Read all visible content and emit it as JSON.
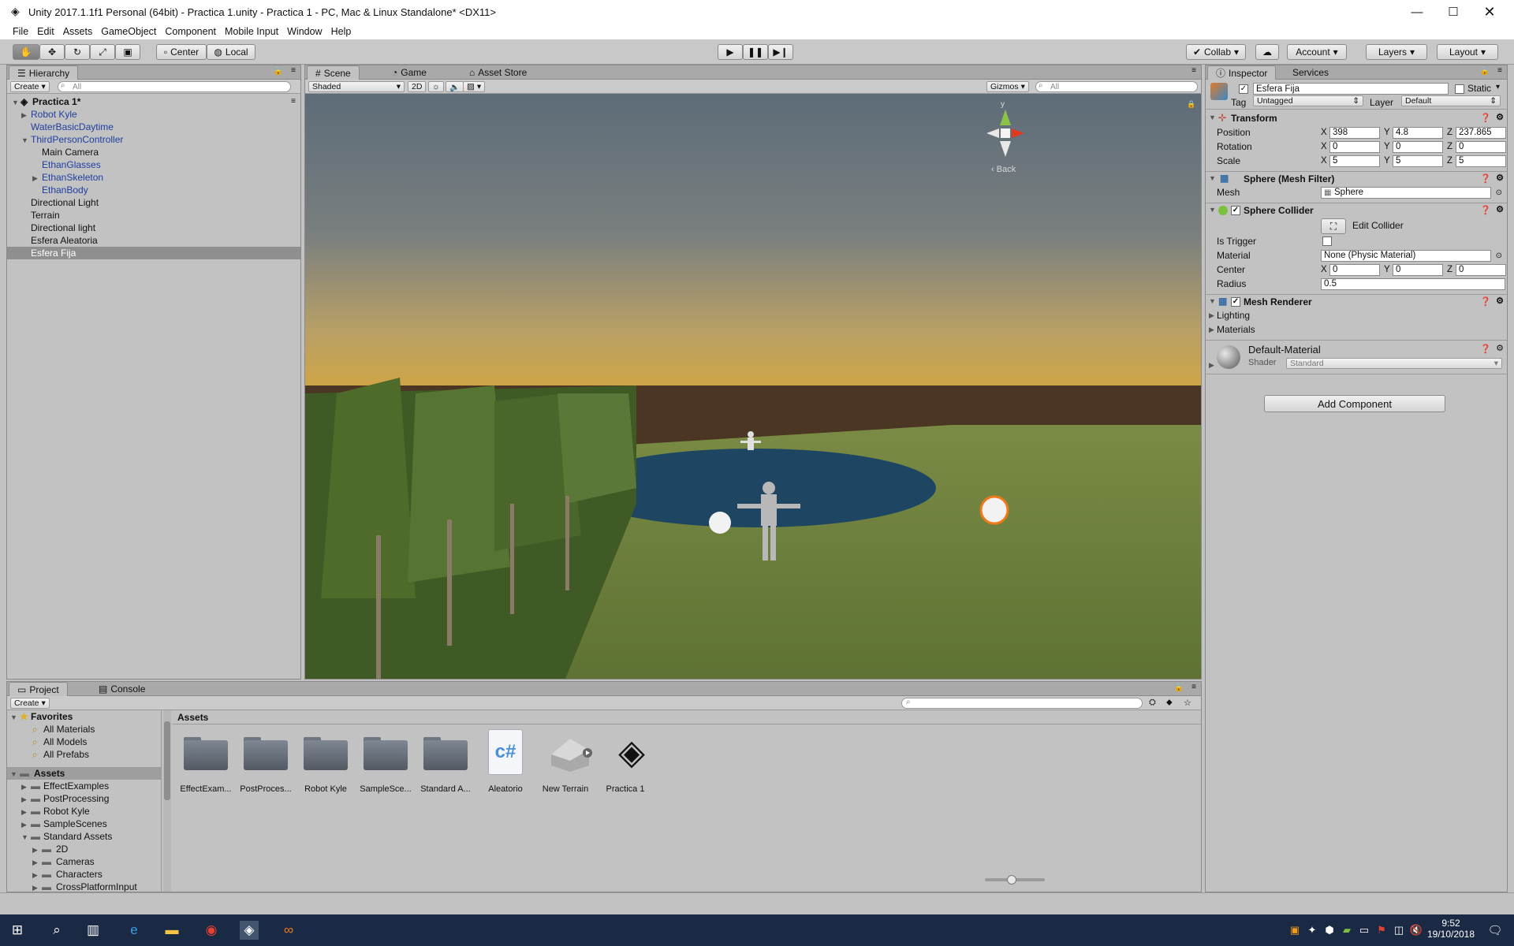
{
  "window": {
    "title": "Unity 2017.1.1f1 Personal (64bit) - Practica 1.unity - Practica 1 - PC, Mac & Linux Standalone* <DX11>"
  },
  "menu": [
    "File",
    "Edit",
    "Assets",
    "GameObject",
    "Component",
    "Mobile Input",
    "Window",
    "Help"
  ],
  "toolbar": {
    "center": "Center",
    "local": "Local",
    "collab": "Collab",
    "account": "Account",
    "layers": "Layers",
    "layout": "Layout"
  },
  "hierarchy": {
    "tab": "Hierarchy",
    "create": "Create",
    "search_placeholder": "All",
    "scene": "Practica 1*",
    "items": [
      {
        "label": "Robot Kyle"
      },
      {
        "label": "WaterBasicDaytime"
      },
      {
        "label": "ThirdPersonController"
      },
      {
        "label": "Main Camera"
      },
      {
        "label": "EthanGlasses"
      },
      {
        "label": "EthanSkeleton"
      },
      {
        "label": "EthanBody"
      },
      {
        "label": "Directional Light"
      },
      {
        "label": "Terrain"
      },
      {
        "label": "Directional light"
      },
      {
        "label": "Esfera Aleatoria"
      },
      {
        "label": "Esfera Fija"
      }
    ]
  },
  "scene": {
    "tabs": [
      "Scene",
      "Game",
      "Asset Store"
    ],
    "shading": "Shaded",
    "mode_2d": "2D",
    "gizmos": "Gizmos",
    "search_placeholder": "All",
    "back": "Back",
    "gizmo_y": "y"
  },
  "inspector": {
    "tabs": [
      "Inspector",
      "Services"
    ],
    "object_name": "Esfera Fija",
    "static": "Static",
    "tag_label": "Tag",
    "tag": "Untagged",
    "layer_label": "Layer",
    "layer": "Default",
    "transform": {
      "title": "Transform",
      "rows": [
        {
          "label": "Position",
          "x": "398",
          "y": "4.8",
          "z": "237.865"
        },
        {
          "label": "Rotation",
          "x": "0",
          "y": "0",
          "z": "0"
        },
        {
          "label": "Scale",
          "x": "5",
          "y": "5",
          "z": "5"
        }
      ]
    },
    "axes": [
      "X",
      "Y",
      "Z"
    ],
    "mesh_filter": {
      "title": "Sphere (Mesh Filter)",
      "mesh_label": "Mesh",
      "mesh": "Sphere"
    },
    "sphere_collider": {
      "title": "Sphere Collider",
      "edit": "Edit Collider",
      "is_trigger": "Is Trigger",
      "material_label": "Material",
      "material": "None (Physic Material)",
      "center_label": "Center",
      "cx": "0",
      "cy": "0",
      "cz": "0",
      "radius_label": "Radius",
      "radius": "0.5"
    },
    "mesh_renderer": {
      "title": "Mesh Renderer",
      "lighting": "Lighting",
      "materials": "Materials"
    },
    "material": {
      "name": "Default-Material",
      "shader_label": "Shader",
      "shader": "Standard"
    },
    "add_component": "Add Component"
  },
  "project": {
    "tabs": [
      "Project",
      "Console"
    ],
    "create": "Create",
    "favorites": {
      "title": "Favorites",
      "items": [
        "All Materials",
        "All Models",
        "All Prefabs"
      ]
    },
    "assets_root": "Assets",
    "tree": [
      "EffectExamples",
      "PostProcessing",
      "Robot Kyle",
      "SampleScenes",
      "Standard Assets",
      "2D",
      "Cameras",
      "Characters",
      "CrossPlatformInput"
    ],
    "breadcrumb": "Assets",
    "items": [
      "EffectExam...",
      "PostProces...",
      "Robot Kyle",
      "SampleSce...",
      "Standard A...",
      "Aleatorio",
      "New Terrain",
      "Practica 1"
    ]
  },
  "taskbar": {
    "time": "9:52",
    "date": "19/10/2018"
  }
}
